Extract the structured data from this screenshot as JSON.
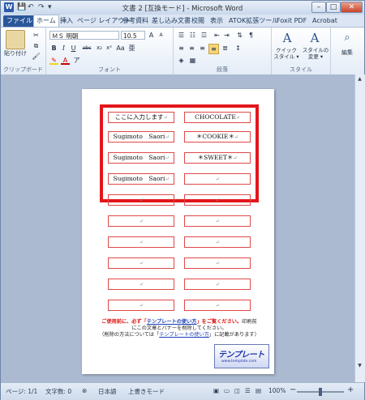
{
  "title": "文書 2 [互換モード] - Microsoft Word",
  "quick_access": {
    "word_logo": "W",
    "save": "💾",
    "undo": "↶",
    "redo": "↷",
    "customize": "▾"
  },
  "window_controls": {
    "minimize": "–",
    "maximize": "□",
    "close": "✕"
  },
  "tabs": [
    "ファイル",
    "ホーム",
    "挿入",
    "ページ レイアウト",
    "参考資料",
    "差し込み文書",
    "校閲",
    "表示",
    "ATOK拡張ツール",
    "Foxit PDF",
    "Acrobat"
  ],
  "ribbon": {
    "clipboard": {
      "paste": "貼り付け",
      "label": "クリップボード"
    },
    "font": {
      "name": "ＭＳ 明朝",
      "size": "10.5",
      "label": "フォント",
      "bold": "B",
      "italic": "I",
      "underline": "U",
      "strike": "abc",
      "sub": "x₂",
      "sup": "x²",
      "color_a": "A",
      "grow": "A",
      "shrink": "A",
      "clear": "Aa",
      "case": "ア",
      "kana": "亜"
    },
    "paragraph": {
      "label": "段落"
    },
    "styles": {
      "quick": "クイック\nスタイル ▾",
      "change": "スタイルの\n変更 ▾",
      "label": "スタイル"
    },
    "editing": {
      "label": "編集"
    }
  },
  "labels": {
    "rows": [
      [
        "ここに入力します",
        "CHOCOLATE"
      ],
      [
        "Sugimoto　Saori",
        "＊COOKIE＊"
      ],
      [
        "Sugimoto　Saori",
        "＊SWEET＊"
      ],
      [
        "Sugimoto　Saori",
        ""
      ],
      [
        "",
        ""
      ],
      [
        "",
        ""
      ],
      [
        "",
        ""
      ],
      [
        "",
        ""
      ],
      [
        "",
        ""
      ],
      [
        "",
        ""
      ]
    ]
  },
  "notice": {
    "line1_red": "ご使用前に、必ず「",
    "line1_link": "テンプレートの使い方",
    "line1_red2": "」をご覧ください。",
    "line1_rest": "印刷前",
    "line2": "にこの文章とバナーを削除してください。",
    "line3_a": "（削除の方法については「",
    "line3_link": "テンプレートの使い方",
    "line3_b": "」に記載があります）"
  },
  "banner": {
    "text": "テンプレート",
    "sub": "www.template.com"
  },
  "status": {
    "page": "ページ: 1/1",
    "words": "文字数: 0",
    "lang": "日本語",
    "mode": "上書きモード",
    "zoom": "100%",
    "zoom_minus": "−",
    "zoom_plus": "+"
  }
}
